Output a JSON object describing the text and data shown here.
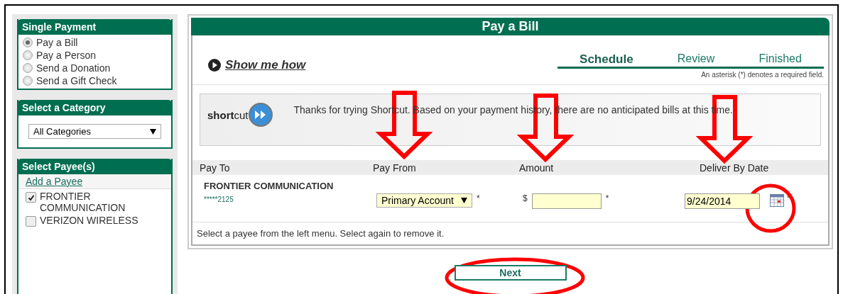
{
  "single_payment": {
    "title": "Single Payment",
    "options": [
      {
        "label": "Pay a Bill",
        "selected": true
      },
      {
        "label": "Pay a Person",
        "selected": false
      },
      {
        "label": "Send a Donation",
        "selected": false
      },
      {
        "label": "Send a Gift Check",
        "selected": false
      }
    ]
  },
  "category": {
    "title": "Select a Category",
    "dropdown": {
      "value": "All Categories"
    }
  },
  "payees": {
    "title": "Select Payee(s)",
    "add_link": "Add a Payee",
    "items": [
      {
        "label": "FRONTIER COMMUNICATION",
        "checked": true
      },
      {
        "label": "VERIZON WIRELESS",
        "checked": false
      }
    ]
  },
  "main": {
    "title": "Pay a Bill",
    "show_me_how": "Show me how",
    "steps": [
      {
        "label": "Schedule",
        "selected": true
      },
      {
        "label": "Review",
        "selected": false
      },
      {
        "label": "Finished",
        "selected": false
      }
    ],
    "required_note": "An asterisk (*) denotes a required field.",
    "shortcut": {
      "logo": "**short**cut",
      "message": "Thanks for trying Shortcut. Based on your payment history, there are no anticipated bills at this time."
    },
    "columns": [
      "Pay To",
      "Pay From",
      "Amount",
      "Deliver By Date"
    ],
    "row": {
      "payee": "FRONTIER COMMUNICATION",
      "account": "*****2125",
      "pay_from": "Primary Account",
      "pay_from_required": "*",
      "currency": "$",
      "amount_required": "*",
      "date": "9/24/2014",
      "date_required": "*"
    },
    "hint": "Select a payee from the left menu. Select again to remove it.",
    "next_button": "Next"
  }
}
